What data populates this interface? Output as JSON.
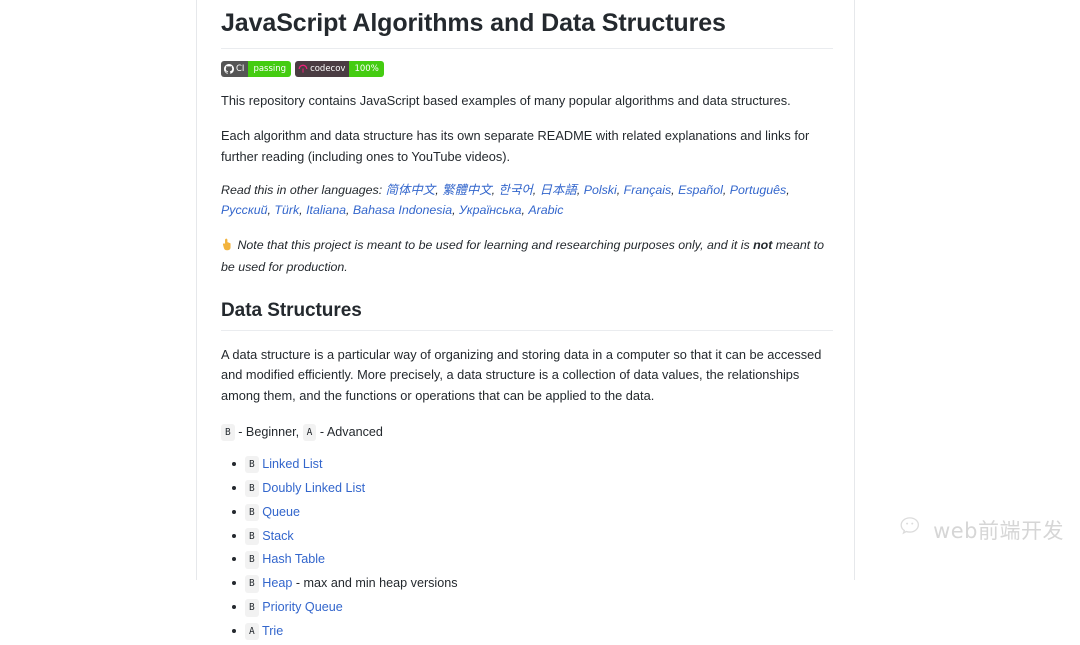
{
  "document": {
    "title": "JavaScript Algorithms and Data Structures",
    "badges": [
      {
        "name": "ci-badge",
        "icon": "github-icon",
        "label": "CI",
        "value": "passing",
        "left_color": "#555555",
        "right_color": "#4c1"
      },
      {
        "name": "codecov-badge",
        "icon": "codecov-umbrella-icon",
        "label": "codecov",
        "value": "100%",
        "left_color": "#555555",
        "right_color": "#4c1"
      }
    ],
    "intro_paragraph": "This repository contains JavaScript based examples of many popular algorithms and data structures.",
    "readme_paragraph": "Each algorithm and data structure has its own separate README with related explanations and links for further reading (including ones to YouTube videos).",
    "languages": {
      "lead": "Read this in other languages: ",
      "items": [
        "简体中文",
        "繁體中文",
        "한국어",
        "日本語",
        "Polski",
        "Français",
        "Español",
        "Português",
        "Русский",
        "Türk",
        "Italiana",
        "Bahasa Indonesia",
        "Українська",
        "Arabic"
      ],
      "separator": ", ",
      "link_color": "#3366cc"
    },
    "note": {
      "emoji": "☝",
      "text_before": " Note that this project is meant to be used for learning and researching purposes only, and it is ",
      "emphasis": "not",
      "text_after": " meant to be used for production."
    },
    "data_structures": {
      "heading": "Data Structures",
      "description": "A data structure is a particular way of organizing and storing data in a computer so that it can be accessed and modified efficiently. More precisely, a data structure is a collection of data values, the relationships among them, and the functions or operations that can be applied to the data.",
      "legend": {
        "beginner_badge": "B",
        "beginner_text": " - Beginner, ",
        "advanced_badge": "A",
        "advanced_text": " - Advanced"
      },
      "items": [
        {
          "level": "B",
          "label": "Linked List",
          "suffix": ""
        },
        {
          "level": "B",
          "label": "Doubly Linked List",
          "suffix": ""
        },
        {
          "level": "B",
          "label": "Queue",
          "suffix": ""
        },
        {
          "level": "B",
          "label": "Stack",
          "suffix": ""
        },
        {
          "level": "B",
          "label": "Hash Table",
          "suffix": ""
        },
        {
          "level": "B",
          "label": "Heap",
          "suffix": " - max and min heap versions"
        },
        {
          "level": "B",
          "label": "Priority Queue",
          "suffix": ""
        },
        {
          "level": "A",
          "label": "Trie",
          "suffix": ""
        }
      ]
    }
  },
  "watermark": {
    "icon": "wechat-icon",
    "text": "web前端开发",
    "color": "#d8d8d8"
  }
}
